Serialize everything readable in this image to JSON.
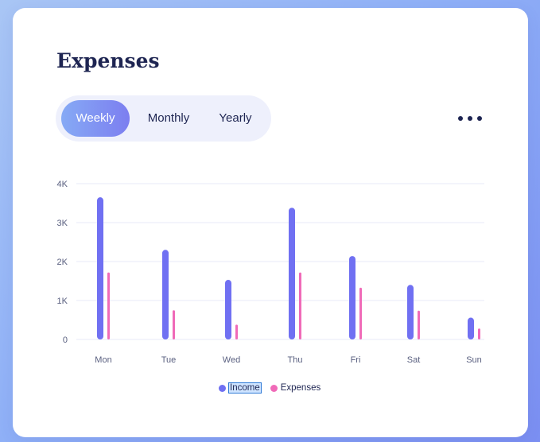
{
  "card": {
    "title": "Expenses"
  },
  "period_tabs": {
    "items": [
      {
        "label": "Weekly",
        "active": true
      },
      {
        "label": "Monthly",
        "active": false
      },
      {
        "label": "Yearly",
        "active": false
      }
    ]
  },
  "more_menu": {
    "icon": "more-horizontal-icon"
  },
  "colors": {
    "income": "#7070f2",
    "expenses": "#f06ab8",
    "accent_gradient_start": "#86aaf5",
    "accent_gradient_end": "#7c7ef0",
    "text": "#1e2552"
  },
  "chart_data": {
    "type": "bar",
    "categories": [
      "Mon",
      "Tue",
      "Wed",
      "Thu",
      "Fri",
      "Sat",
      "Sun"
    ],
    "series": [
      {
        "name": "Income",
        "values": [
          3650,
          2300,
          1530,
          3380,
          2140,
          1400,
          560
        ]
      },
      {
        "name": "Expenses",
        "values": [
          1720,
          750,
          380,
          1720,
          1330,
          740,
          280
        ]
      }
    ],
    "y_ticks": [
      "0",
      "1K",
      "2K",
      "3K",
      "4K"
    ],
    "ylim": [
      0,
      4000
    ],
    "grid": true,
    "legend": "bottom-center"
  },
  "legend": {
    "items": [
      {
        "label": "Income",
        "selected": true
      },
      {
        "label": "Expenses",
        "selected": false
      }
    ]
  }
}
